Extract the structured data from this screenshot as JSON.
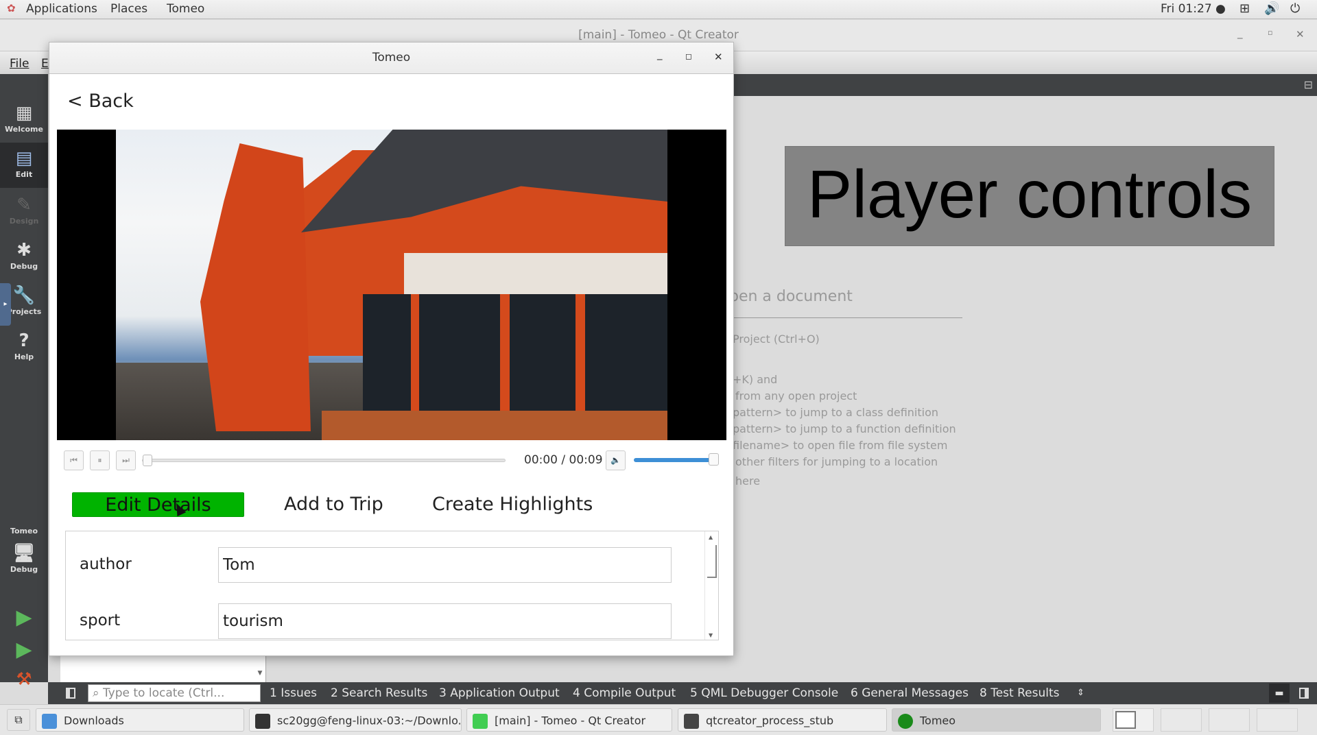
{
  "topbar": {
    "menus": [
      "Applications",
      "Places",
      "Tomeo"
    ],
    "clock": "Fri 01:27 ●",
    "icons": [
      "network-icon",
      "volume-icon",
      "power-icon"
    ]
  },
  "qtcreator": {
    "title": "[main] - Tomeo - Qt Creator",
    "menu": [
      "File",
      "E"
    ],
    "sidebar": [
      {
        "label": "Welcome",
        "icon": "grid-icon"
      },
      {
        "label": "Edit",
        "icon": "document-icon"
      },
      {
        "label": "Design",
        "icon": "pencil-icon"
      },
      {
        "label": "Debug",
        "icon": "bug-icon"
      },
      {
        "label": "Projects",
        "icon": "wrench-icon"
      },
      {
        "label": "Help",
        "icon": "help-icon"
      }
    ],
    "kit": {
      "project": "Tomeo",
      "mode": "Debug"
    },
    "welcome": {
      "heading": "pen a document",
      "lines": [
        "Project (Ctrl+O)",
        "+K) and",
        "from any open project",
        "pattern> to jump to a class definition",
        "pattern> to jump to a function definition",
        "filename> to open file from file system",
        "other filters for jumping to a location",
        "here"
      ]
    },
    "overlay_label": "Player controls",
    "locator_placeholder": "Type to locate (Ctrl...",
    "output_tabs": [
      "1 Issues",
      "2 Search Results",
      "3 Application Output",
      "4 Compile Output",
      "5 QML Debugger Console",
      "6 General Messages",
      "8 Test Results"
    ]
  },
  "tomeo": {
    "title": "Tomeo",
    "back_label": "< Back",
    "player": {
      "time": "00:00 / 00:09",
      "progress": 0.0,
      "volume": 1.0
    },
    "tabs": [
      "Edit Details",
      "Add to Trip",
      "Create Highlights"
    ],
    "active_tab": "Edit Details",
    "fields": [
      {
        "label": "author",
        "value": "Tom"
      },
      {
        "label": "sport",
        "value": "tourism"
      }
    ]
  },
  "taskbar": {
    "items": [
      {
        "label": "Downloads"
      },
      {
        "label": "sc20gg@feng-linux-03:~/Downlo..."
      },
      {
        "label": "[main] - Tomeo - Qt Creator"
      },
      {
        "label": "qtcreator_process_stub"
      },
      {
        "label": "Tomeo"
      }
    ]
  },
  "colors": {
    "active_tab": "#00b300",
    "volume": "#3d8fd6",
    "sidebar": "#404244"
  }
}
